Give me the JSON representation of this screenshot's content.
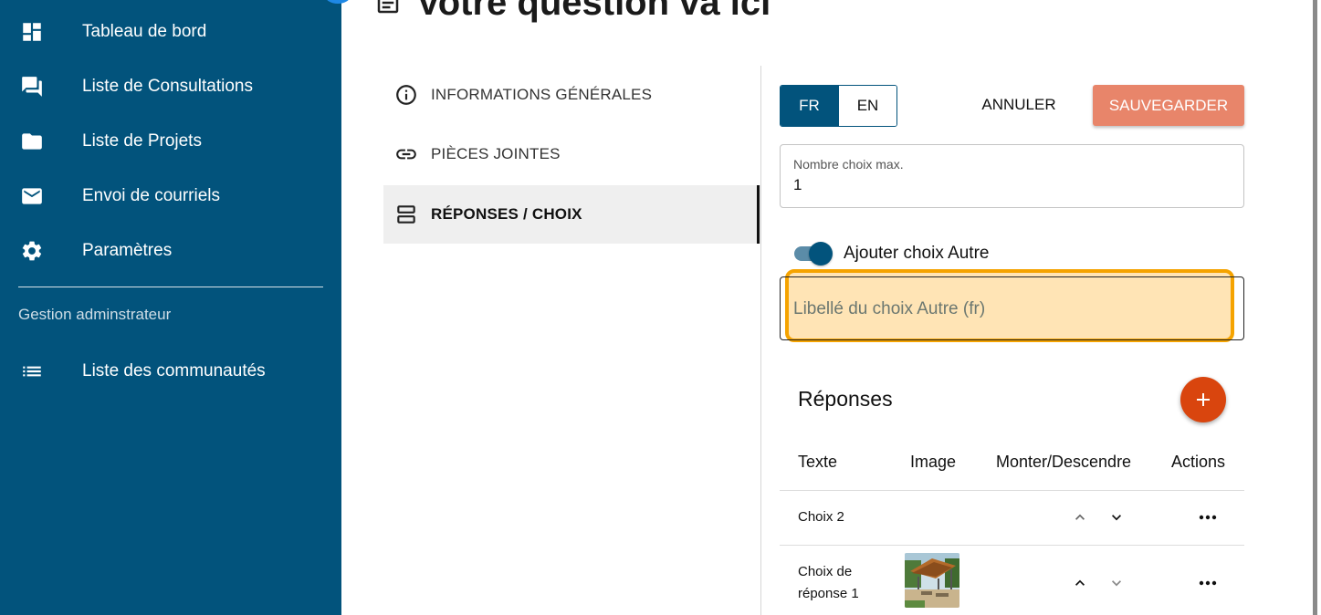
{
  "sidebar": {
    "items": [
      {
        "label": "Tableau de bord",
        "icon": "dashboard-icon"
      },
      {
        "label": "Liste de Consultations",
        "icon": "forum-icon"
      },
      {
        "label": "Liste de Projets",
        "icon": "folder-icon"
      },
      {
        "label": "Envoi de courriels",
        "icon": "mail-icon"
      },
      {
        "label": "Paramètres",
        "icon": "gear-icon"
      }
    ],
    "section_title": "Gestion adminstrateur",
    "admin_items": [
      {
        "label": "Liste des communautés",
        "icon": "list-icon"
      }
    ],
    "background": "#02537c"
  },
  "header": {
    "title": "Votre question va ici",
    "icon": "document-icon"
  },
  "tabs": [
    {
      "label": "INFORMATIONS GÉNÉRALES",
      "icon": "info-icon",
      "active": false
    },
    {
      "label": "PIÈCES JOINTES",
      "icon": "link-icon",
      "active": false
    },
    {
      "label": "RÉPONSES / CHOIX",
      "icon": "view-agenda-icon",
      "active": true
    }
  ],
  "language": {
    "options": [
      "FR",
      "EN"
    ],
    "selected": "FR"
  },
  "actions": {
    "cancel_label": "ANNULER",
    "save_label": "SAUVEGARDER",
    "save_color": "#e8856a"
  },
  "max_choices": {
    "label": "Nombre choix max.",
    "value": "1"
  },
  "other_choice": {
    "toggle_label": "Ajouter choix Autre",
    "enabled": true,
    "input_placeholder": "Libellé du choix Autre (fr)",
    "input_value": ""
  },
  "responses": {
    "title": "Réponses",
    "add_button_icon": "plus-icon",
    "add_button_color": "#d9450e",
    "columns": [
      "Texte",
      "Image",
      "Monter/Descendre",
      "Actions"
    ],
    "rows": [
      {
        "text": "Choix 2",
        "has_image": false
      },
      {
        "text_lines": [
          "Choix de",
          "réponse 1"
        ],
        "has_image": true,
        "image": "pergola-photo"
      }
    ]
  },
  "highlight_color": "#f5a300"
}
